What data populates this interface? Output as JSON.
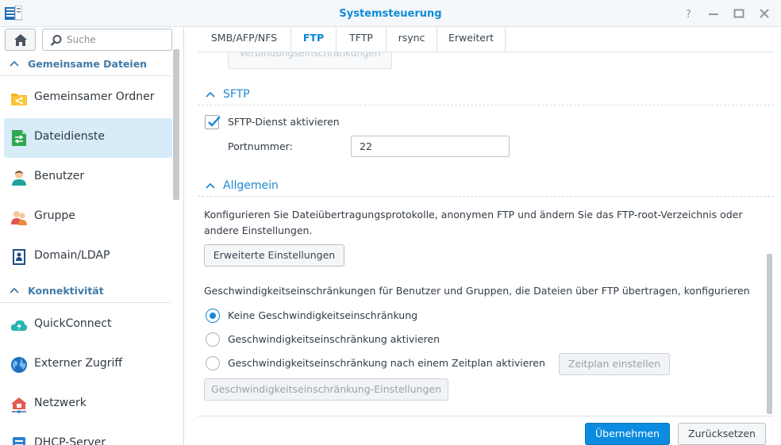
{
  "window": {
    "title": "Systemsteuerung"
  },
  "sidebar": {
    "search_placeholder": "Suche",
    "sections": [
      {
        "label": "Gemeinsame Dateien"
      },
      {
        "label": "Konnektivität"
      }
    ],
    "items": [
      {
        "label": "Gemeinsamer Ordner",
        "icon": "shared-folder-icon"
      },
      {
        "label": "Dateidienste",
        "icon": "file-services-icon",
        "active": true
      },
      {
        "label": "Benutzer",
        "icon": "user-icon"
      },
      {
        "label": "Gruppe",
        "icon": "group-icon"
      },
      {
        "label": "Domain/LDAP",
        "icon": "domain-ldap-icon"
      },
      {
        "label": "QuickConnect",
        "icon": "quickconnect-icon"
      },
      {
        "label": "Externer Zugriff",
        "icon": "external-access-icon"
      },
      {
        "label": "Netzwerk",
        "icon": "network-icon"
      },
      {
        "label": "DHCP-Server",
        "icon": "dhcp-server-icon"
      }
    ]
  },
  "tabs": [
    {
      "label": "SMB/AFP/NFS"
    },
    {
      "label": "FTP",
      "active": true
    },
    {
      "label": "TFTP"
    },
    {
      "label": "rsync"
    },
    {
      "label": "Erweitert"
    }
  ],
  "content": {
    "connection_limits_button": "Verbindungseinschränkungen",
    "sftp": {
      "title": "SFTP",
      "enable_label": "SFTP-Dienst aktivieren",
      "enable_checked": true,
      "port_label": "Portnummer:",
      "port_value": "22"
    },
    "general": {
      "title": "Allgemein",
      "description": "Konfigurieren Sie Dateiübertragungsprotokolle, anonymen FTP und ändern Sie das FTP-root-Verzeichnis oder andere Einstellungen.",
      "advanced_button": "Erweiterte Einstellungen",
      "speed_description": "Geschwindigkeitseinschränkungen für Benutzer und Gruppen, die Dateien über FTP übertragen, konfigurieren",
      "options": [
        {
          "label": "Keine Geschwindigkeitseinschränkung",
          "selected": true
        },
        {
          "label": "Geschwindigkeitseinschränkung aktivieren",
          "selected": false
        },
        {
          "label": "Geschwindigkeitseinschränkung nach einem Zeitplan aktivieren",
          "selected": false
        }
      ],
      "schedule_button": "Zeitplan einstellen",
      "speed_settings_button": "Geschwindigkeitseinschränkung-Einstellungen"
    }
  },
  "footer": {
    "apply_button": "Übernehmen",
    "reset_button": "Zurücksetzen"
  },
  "colors": {
    "accent": "#0c8ce0",
    "active_nav": "#d7ebf8",
    "section_title": "#1f8ad3"
  }
}
